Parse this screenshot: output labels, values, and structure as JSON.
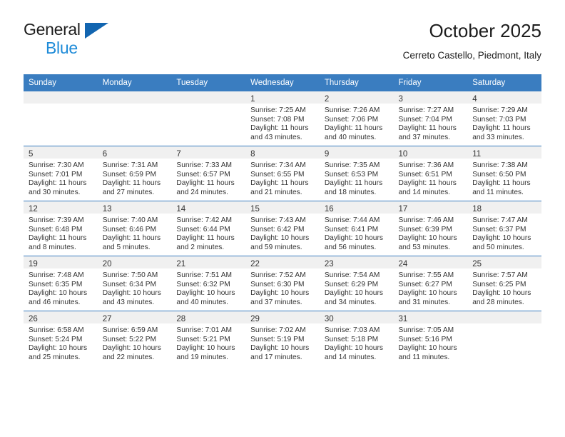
{
  "brand": {
    "name_top": "General",
    "name_bottom": "Blue",
    "triangle_color": "#1265b0",
    "blue_color": "#1e8bd8"
  },
  "header": {
    "title": "October 2025",
    "location": "Cerreto Castello, Piedmont, Italy"
  },
  "calendar": {
    "accent_color": "#3a7dc0",
    "daynum_band_color": "#f0f0f0",
    "weekday_headers": [
      "Sunday",
      "Monday",
      "Tuesday",
      "Wednesday",
      "Thursday",
      "Friday",
      "Saturday"
    ],
    "labels": {
      "sunrise": "Sunrise:",
      "sunset": "Sunset:",
      "daylight": "Daylight:"
    },
    "weeks": [
      [
        {
          "day": "",
          "sunrise": "",
          "sunset": "",
          "daylight_line1": "",
          "daylight_line2": ""
        },
        {
          "day": "",
          "sunrise": "",
          "sunset": "",
          "daylight_line1": "",
          "daylight_line2": ""
        },
        {
          "day": "",
          "sunrise": "",
          "sunset": "",
          "daylight_line1": "",
          "daylight_line2": ""
        },
        {
          "day": "1",
          "sunrise": "Sunrise: 7:25 AM",
          "sunset": "Sunset: 7:08 PM",
          "daylight_line1": "Daylight: 11 hours",
          "daylight_line2": "and 43 minutes."
        },
        {
          "day": "2",
          "sunrise": "Sunrise: 7:26 AM",
          "sunset": "Sunset: 7:06 PM",
          "daylight_line1": "Daylight: 11 hours",
          "daylight_line2": "and 40 minutes."
        },
        {
          "day": "3",
          "sunrise": "Sunrise: 7:27 AM",
          "sunset": "Sunset: 7:04 PM",
          "daylight_line1": "Daylight: 11 hours",
          "daylight_line2": "and 37 minutes."
        },
        {
          "day": "4",
          "sunrise": "Sunrise: 7:29 AM",
          "sunset": "Sunset: 7:03 PM",
          "daylight_line1": "Daylight: 11 hours",
          "daylight_line2": "and 33 minutes."
        }
      ],
      [
        {
          "day": "5",
          "sunrise": "Sunrise: 7:30 AM",
          "sunset": "Sunset: 7:01 PM",
          "daylight_line1": "Daylight: 11 hours",
          "daylight_line2": "and 30 minutes."
        },
        {
          "day": "6",
          "sunrise": "Sunrise: 7:31 AM",
          "sunset": "Sunset: 6:59 PM",
          "daylight_line1": "Daylight: 11 hours",
          "daylight_line2": "and 27 minutes."
        },
        {
          "day": "7",
          "sunrise": "Sunrise: 7:33 AM",
          "sunset": "Sunset: 6:57 PM",
          "daylight_line1": "Daylight: 11 hours",
          "daylight_line2": "and 24 minutes."
        },
        {
          "day": "8",
          "sunrise": "Sunrise: 7:34 AM",
          "sunset": "Sunset: 6:55 PM",
          "daylight_line1": "Daylight: 11 hours",
          "daylight_line2": "and 21 minutes."
        },
        {
          "day": "9",
          "sunrise": "Sunrise: 7:35 AM",
          "sunset": "Sunset: 6:53 PM",
          "daylight_line1": "Daylight: 11 hours",
          "daylight_line2": "and 18 minutes."
        },
        {
          "day": "10",
          "sunrise": "Sunrise: 7:36 AM",
          "sunset": "Sunset: 6:51 PM",
          "daylight_line1": "Daylight: 11 hours",
          "daylight_line2": "and 14 minutes."
        },
        {
          "day": "11",
          "sunrise": "Sunrise: 7:38 AM",
          "sunset": "Sunset: 6:50 PM",
          "daylight_line1": "Daylight: 11 hours",
          "daylight_line2": "and 11 minutes."
        }
      ],
      [
        {
          "day": "12",
          "sunrise": "Sunrise: 7:39 AM",
          "sunset": "Sunset: 6:48 PM",
          "daylight_line1": "Daylight: 11 hours",
          "daylight_line2": "and 8 minutes."
        },
        {
          "day": "13",
          "sunrise": "Sunrise: 7:40 AM",
          "sunset": "Sunset: 6:46 PM",
          "daylight_line1": "Daylight: 11 hours",
          "daylight_line2": "and 5 minutes."
        },
        {
          "day": "14",
          "sunrise": "Sunrise: 7:42 AM",
          "sunset": "Sunset: 6:44 PM",
          "daylight_line1": "Daylight: 11 hours",
          "daylight_line2": "and 2 minutes."
        },
        {
          "day": "15",
          "sunrise": "Sunrise: 7:43 AM",
          "sunset": "Sunset: 6:42 PM",
          "daylight_line1": "Daylight: 10 hours",
          "daylight_line2": "and 59 minutes."
        },
        {
          "day": "16",
          "sunrise": "Sunrise: 7:44 AM",
          "sunset": "Sunset: 6:41 PM",
          "daylight_line1": "Daylight: 10 hours",
          "daylight_line2": "and 56 minutes."
        },
        {
          "day": "17",
          "sunrise": "Sunrise: 7:46 AM",
          "sunset": "Sunset: 6:39 PM",
          "daylight_line1": "Daylight: 10 hours",
          "daylight_line2": "and 53 minutes."
        },
        {
          "day": "18",
          "sunrise": "Sunrise: 7:47 AM",
          "sunset": "Sunset: 6:37 PM",
          "daylight_line1": "Daylight: 10 hours",
          "daylight_line2": "and 50 minutes."
        }
      ],
      [
        {
          "day": "19",
          "sunrise": "Sunrise: 7:48 AM",
          "sunset": "Sunset: 6:35 PM",
          "daylight_line1": "Daylight: 10 hours",
          "daylight_line2": "and 46 minutes."
        },
        {
          "day": "20",
          "sunrise": "Sunrise: 7:50 AM",
          "sunset": "Sunset: 6:34 PM",
          "daylight_line1": "Daylight: 10 hours",
          "daylight_line2": "and 43 minutes."
        },
        {
          "day": "21",
          "sunrise": "Sunrise: 7:51 AM",
          "sunset": "Sunset: 6:32 PM",
          "daylight_line1": "Daylight: 10 hours",
          "daylight_line2": "and 40 minutes."
        },
        {
          "day": "22",
          "sunrise": "Sunrise: 7:52 AM",
          "sunset": "Sunset: 6:30 PM",
          "daylight_line1": "Daylight: 10 hours",
          "daylight_line2": "and 37 minutes."
        },
        {
          "day": "23",
          "sunrise": "Sunrise: 7:54 AM",
          "sunset": "Sunset: 6:29 PM",
          "daylight_line1": "Daylight: 10 hours",
          "daylight_line2": "and 34 minutes."
        },
        {
          "day": "24",
          "sunrise": "Sunrise: 7:55 AM",
          "sunset": "Sunset: 6:27 PM",
          "daylight_line1": "Daylight: 10 hours",
          "daylight_line2": "and 31 minutes."
        },
        {
          "day": "25",
          "sunrise": "Sunrise: 7:57 AM",
          "sunset": "Sunset: 6:25 PM",
          "daylight_line1": "Daylight: 10 hours",
          "daylight_line2": "and 28 minutes."
        }
      ],
      [
        {
          "day": "26",
          "sunrise": "Sunrise: 6:58 AM",
          "sunset": "Sunset: 5:24 PM",
          "daylight_line1": "Daylight: 10 hours",
          "daylight_line2": "and 25 minutes."
        },
        {
          "day": "27",
          "sunrise": "Sunrise: 6:59 AM",
          "sunset": "Sunset: 5:22 PM",
          "daylight_line1": "Daylight: 10 hours",
          "daylight_line2": "and 22 minutes."
        },
        {
          "day": "28",
          "sunrise": "Sunrise: 7:01 AM",
          "sunset": "Sunset: 5:21 PM",
          "daylight_line1": "Daylight: 10 hours",
          "daylight_line2": "and 19 minutes."
        },
        {
          "day": "29",
          "sunrise": "Sunrise: 7:02 AM",
          "sunset": "Sunset: 5:19 PM",
          "daylight_line1": "Daylight: 10 hours",
          "daylight_line2": "and 17 minutes."
        },
        {
          "day": "30",
          "sunrise": "Sunrise: 7:03 AM",
          "sunset": "Sunset: 5:18 PM",
          "daylight_line1": "Daylight: 10 hours",
          "daylight_line2": "and 14 minutes."
        },
        {
          "day": "31",
          "sunrise": "Sunrise: 7:05 AM",
          "sunset": "Sunset: 5:16 PM",
          "daylight_line1": "Daylight: 10 hours",
          "daylight_line2": "and 11 minutes."
        },
        {
          "day": "",
          "sunrise": "",
          "sunset": "",
          "daylight_line1": "",
          "daylight_line2": ""
        }
      ]
    ]
  }
}
